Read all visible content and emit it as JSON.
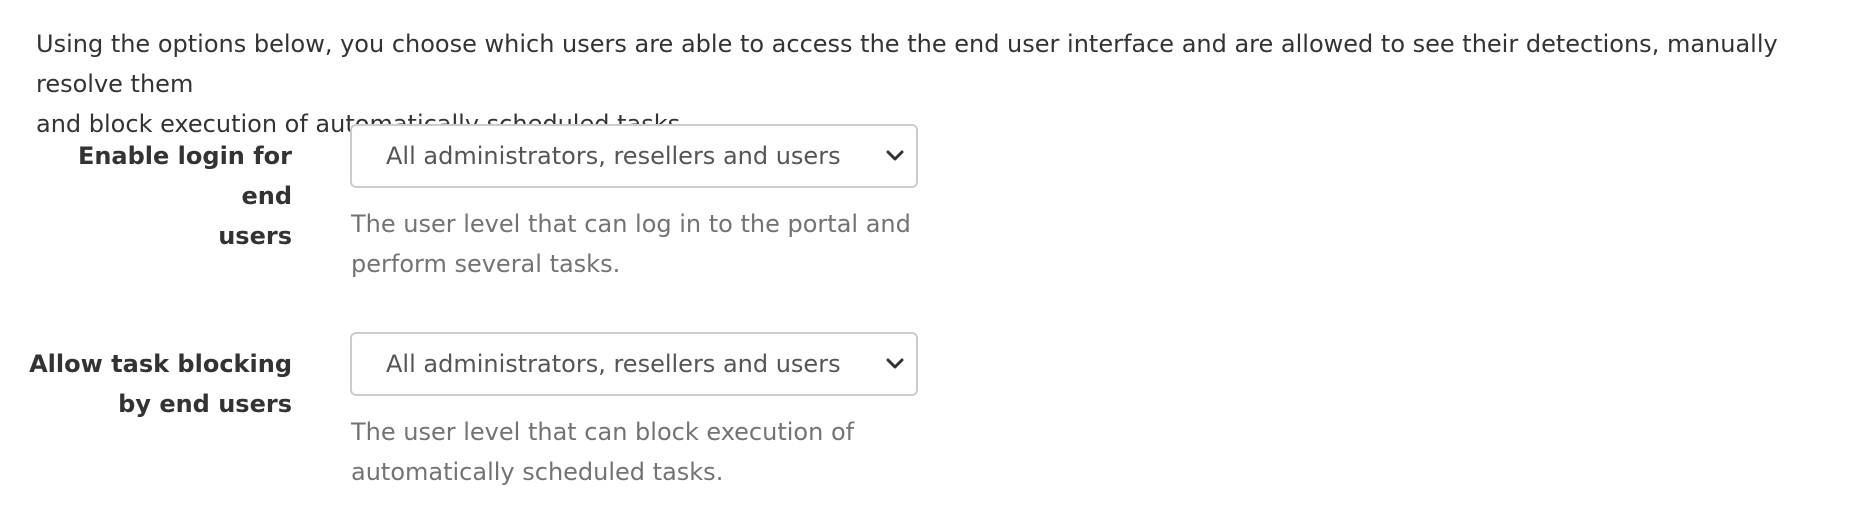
{
  "intro": {
    "line1": "Using the options below, you choose which users are able to access the the end user interface and are allowed to see their detections, manually resolve them",
    "line2": "and block execution of automatically scheduled tasks."
  },
  "fields": [
    {
      "label_line1": "Enable login for end",
      "label_line2": "users",
      "selected_value": "All administrators, resellers and users",
      "help_line1": "The user level that can log in to the portal and",
      "help_line2": "perform several tasks."
    },
    {
      "label_line1": "Allow task blocking",
      "label_line2": "by end users",
      "selected_value": "All administrators, resellers and users",
      "help_line1": "The user level that can block execution of",
      "help_line2": "automatically scheduled tasks."
    }
  ],
  "icons": {
    "select_arrow": "chevron-down-icon"
  },
  "colors": {
    "text": "#333333",
    "help_text": "#737373",
    "select_border": "#cccccc",
    "select_text": "#555555"
  }
}
